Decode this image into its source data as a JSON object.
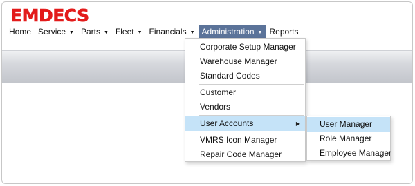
{
  "logo": {
    "text": "EMDECS",
    "color": "#e31b1b"
  },
  "menubar": {
    "items": [
      {
        "label": "Home",
        "has_caret": false
      },
      {
        "label": "Service",
        "has_caret": true
      },
      {
        "label": "Parts",
        "has_caret": true
      },
      {
        "label": "Fleet",
        "has_caret": true
      },
      {
        "label": "Financials",
        "has_caret": true
      },
      {
        "label": "Administration",
        "has_caret": true,
        "active": true
      },
      {
        "label": "Reports",
        "has_caret": false
      }
    ],
    "caret_icon": "triangle-down"
  },
  "administration_menu": {
    "groups": [
      [
        "Corporate Setup Manager",
        "Warehouse Manager",
        "Standard Codes"
      ],
      [
        "Customer",
        "Vendors"
      ],
      [
        "User Accounts"
      ],
      [
        "VMRS Icon Manager",
        "Repair Code Manager"
      ]
    ],
    "highlighted": "User Accounts",
    "submenu_arrow_icon": "triangle-right"
  },
  "user_accounts_submenu": {
    "items": [
      "User Manager",
      "Role Manager",
      "Employee Manager"
    ],
    "highlighted": "User Manager"
  },
  "colors": {
    "active_menu_bg": "#5b7399",
    "highlight_bg": "#c5e3f8"
  }
}
